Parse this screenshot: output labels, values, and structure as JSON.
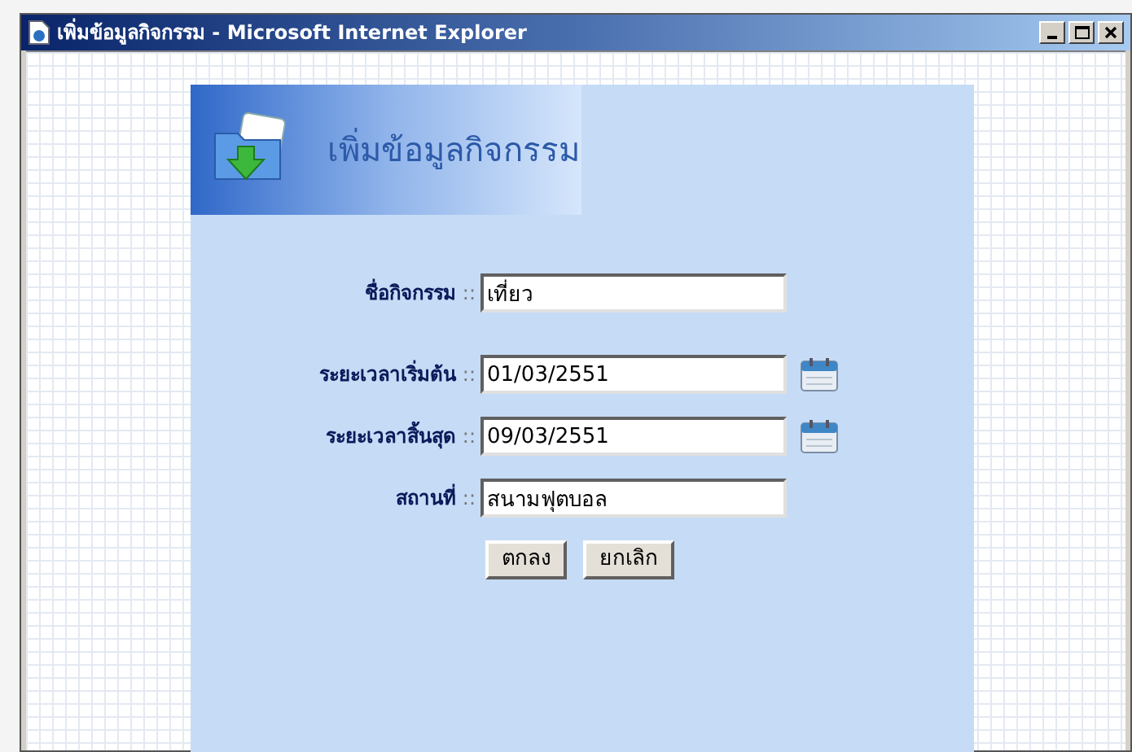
{
  "window": {
    "title": "เพิ่มข้อมูลกิจกรรม - Microsoft Internet Explorer"
  },
  "header": {
    "title": "เพิ่มข้อมูลกิจกรรม"
  },
  "fields": [
    {
      "kind": "text",
      "label": "ชื่อกิจกรรม",
      "separator": "::",
      "value": "เที่ยว"
    },
    {
      "kind": "date",
      "label": "ระยะเวลาเริ่มต้น",
      "separator": "::",
      "value": "01/03/2551"
    },
    {
      "kind": "date",
      "label": "ระยะเวลาสิ้นสุด",
      "separator": "::",
      "value": "09/03/2551"
    },
    {
      "kind": "text",
      "label": "สถานที่",
      "separator": "::",
      "value": "สนามฟุตบอล"
    }
  ],
  "buttons": [
    "ตกลง",
    "ยกเลิก"
  ]
}
